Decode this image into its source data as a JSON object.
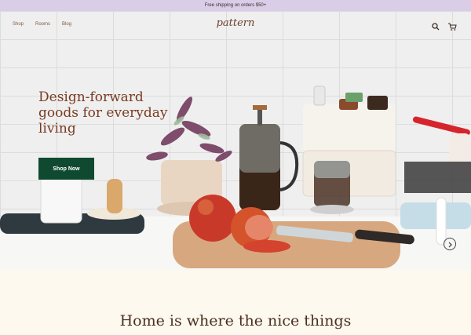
{
  "announcement": {
    "text": "Free shipping on orders $50+"
  },
  "nav": {
    "links": [
      "Shop",
      "Rooms",
      "Blog"
    ],
    "logo": "pattern",
    "icons": [
      "search-icon",
      "cart-icon"
    ]
  },
  "hero": {
    "headline": "Design-forward goods for everyday living",
    "cta": "Shop Now",
    "next_icon": "arrow-right-icon"
  },
  "section": {
    "heading": "Home is where the nice things"
  },
  "colors": {
    "announcement_bg": "#d9cde8",
    "brand_text": "#7a3b22",
    "cta_bg": "#0f4a30",
    "page_bg": "#fdf9ee"
  }
}
